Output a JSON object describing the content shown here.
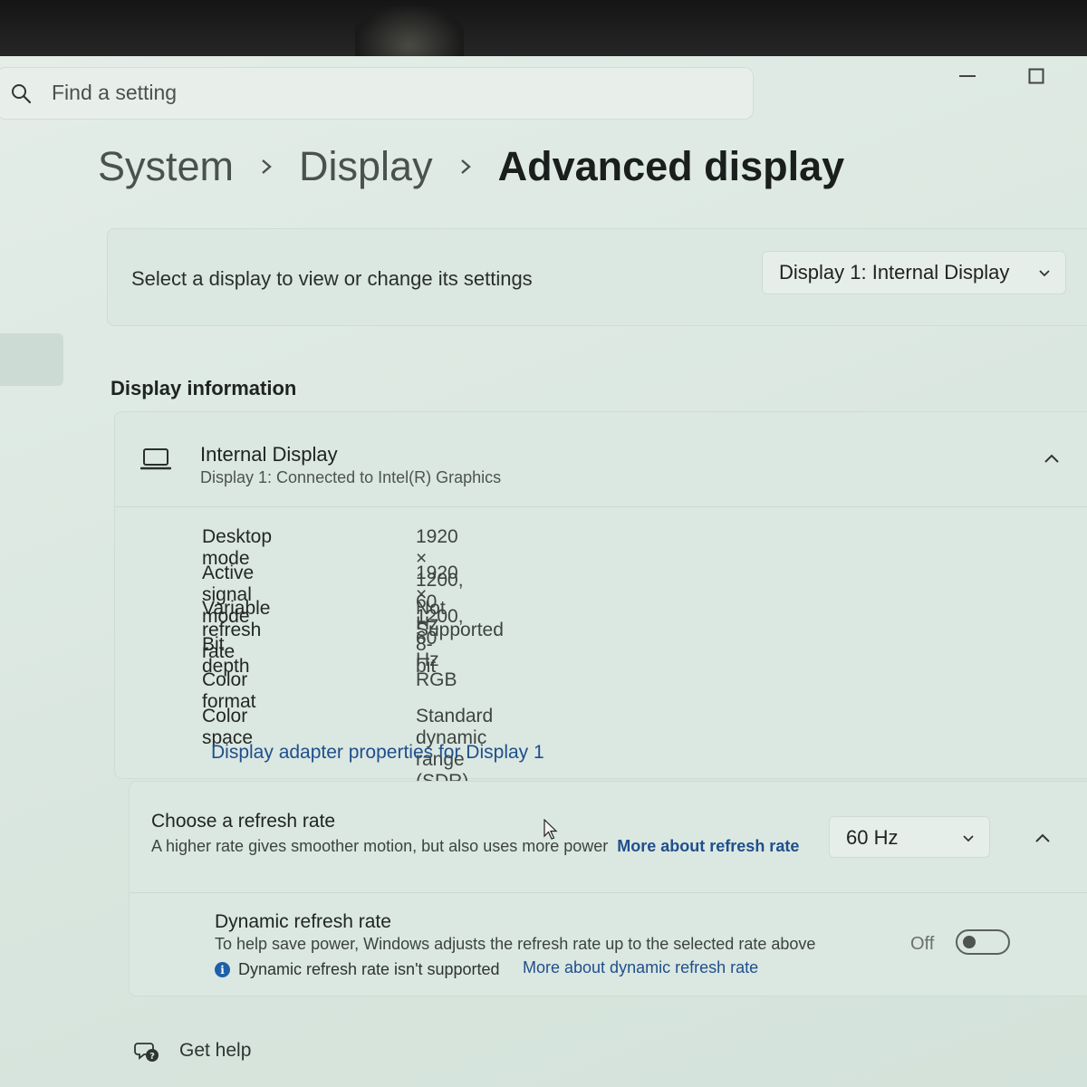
{
  "search": {
    "placeholder": "Find a setting"
  },
  "breadcrumb": {
    "items": [
      "System",
      "Display"
    ],
    "current": "Advanced display"
  },
  "display_select": {
    "label": "Select a display to view or change its settings",
    "selected": "Display 1: Internal Display"
  },
  "display_info": {
    "section_title": "Display information",
    "name": "Internal Display",
    "subtitle": "Display 1: Connected to Intel(R) Graphics",
    "rows": [
      {
        "label": "Desktop mode",
        "value": "1920 × 1200, 60 Hz"
      },
      {
        "label": "Active signal mode",
        "value": "1920 × 1200, 60 Hz"
      },
      {
        "label": "Variable refresh rate",
        "value": "Not Supported"
      },
      {
        "label": "Bit depth",
        "value": "8-bit"
      },
      {
        "label": "Color format",
        "value": "RGB"
      },
      {
        "label": "Color space",
        "value": "Standard dynamic range (SDR)"
      }
    ],
    "adapter_link": "Display adapter properties for Display 1"
  },
  "refresh": {
    "title": "Choose a refresh rate",
    "description": "A higher rate gives smoother motion, but also uses more power",
    "link": "More about refresh rate",
    "selected": "60 Hz"
  },
  "dynamic_refresh": {
    "title": "Dynamic refresh rate",
    "description": "To help save power, Windows adjusts the refresh rate up to the selected rate above",
    "note": "Dynamic refresh rate isn't supported",
    "link": "More about dynamic refresh rate",
    "state_label": "Off",
    "enabled": false
  },
  "get_help": {
    "label": "Get help"
  },
  "icons": {
    "search": "search-icon",
    "minimize": "minimize-icon",
    "maximize": "maximize-icon",
    "laptop": "laptop-icon",
    "chevron": "chevron-down-icon",
    "collapse": "chevron-up-icon",
    "info": "info-icon",
    "help": "help-chat-icon"
  },
  "colors": {
    "link": "#1f4f8c",
    "info_dot": "#1f5fa8",
    "background": "#dfe9e3"
  }
}
